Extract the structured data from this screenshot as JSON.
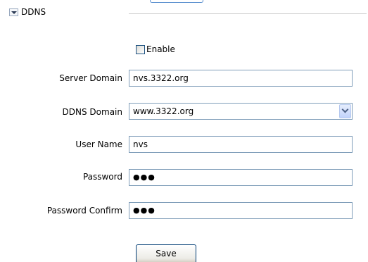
{
  "section": {
    "title": "DDNS",
    "toggle_icon": "chevron-down-icon"
  },
  "enable": {
    "label": "Enable",
    "checked": false
  },
  "form": {
    "server_domain": {
      "label": "Server Domain",
      "value": "nvs.3322.org"
    },
    "ddns_domain": {
      "label": "DDNS Domain",
      "value": "www.3322.org"
    },
    "user_name": {
      "label": "User Name",
      "value": "nvs"
    },
    "password": {
      "label": "Password",
      "value": "●●●"
    },
    "password_confirm": {
      "label": "Password Confirm",
      "value": "●●●"
    }
  },
  "buttons": {
    "save_label": "Save"
  }
}
